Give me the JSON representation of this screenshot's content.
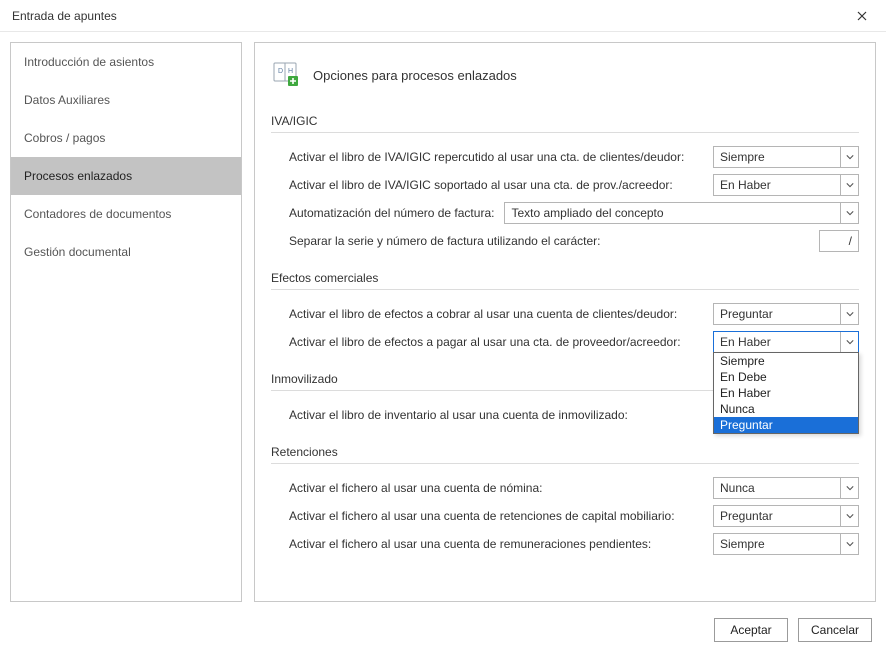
{
  "window": {
    "title": "Entrada de apuntes"
  },
  "sidebar": {
    "items": [
      {
        "label": "Introducción de asientos"
      },
      {
        "label": "Datos Auxiliares"
      },
      {
        "label": "Cobros / pagos"
      },
      {
        "label": "Procesos enlazados"
      },
      {
        "label": "Contadores de documentos"
      },
      {
        "label": "Gestión documental"
      }
    ],
    "selected_index": 3
  },
  "page": {
    "title": "Opciones para procesos enlazados"
  },
  "sections": {
    "iva": {
      "title": "IVA/IGIC",
      "row1_label": "Activar el libro de IVA/IGIC repercutido al usar una cta. de clientes/deudor:",
      "row1_value": "Siempre",
      "row2_label": "Activar el libro de IVA/IGIC soportado al usar una cta. de prov./acreedor:",
      "row2_value": "En Haber",
      "row3_label": "Automatización del número de factura:",
      "row3_value": "Texto ampliado del concepto",
      "row4_label": "Separar la serie y número de factura utilizando el carácter:",
      "row4_value": "/"
    },
    "efectos": {
      "title": "Efectos comerciales",
      "row1_label": "Activar el libro de efectos a cobrar al usar una cuenta de clientes/deudor:",
      "row1_value": "Preguntar",
      "row2_label": "Activar el libro de efectos a pagar al usar una cta. de proveedor/acreedor:",
      "row2_value": "En Haber",
      "row2_options": [
        "Siempre",
        "En Debe",
        "En Haber",
        "Nunca",
        "Preguntar"
      ],
      "row2_highlight_index": 4
    },
    "inmov": {
      "title": "Inmovilizado",
      "row1_label": "Activar el libro de inventario al usar una cuenta de inmovilizado:"
    },
    "reten": {
      "title": "Retenciones",
      "row1_label": "Activar el fichero al usar una cuenta de nómina:",
      "row1_value": "Nunca",
      "row2_label": "Activar el fichero al usar una cuenta de retenciones de capital mobiliario:",
      "row2_value": "Preguntar",
      "row3_label": "Activar el fichero al usar una cuenta de remuneraciones pendientes:",
      "row3_value": "Siempre"
    }
  },
  "footer": {
    "accept": "Aceptar",
    "cancel": "Cancelar"
  }
}
